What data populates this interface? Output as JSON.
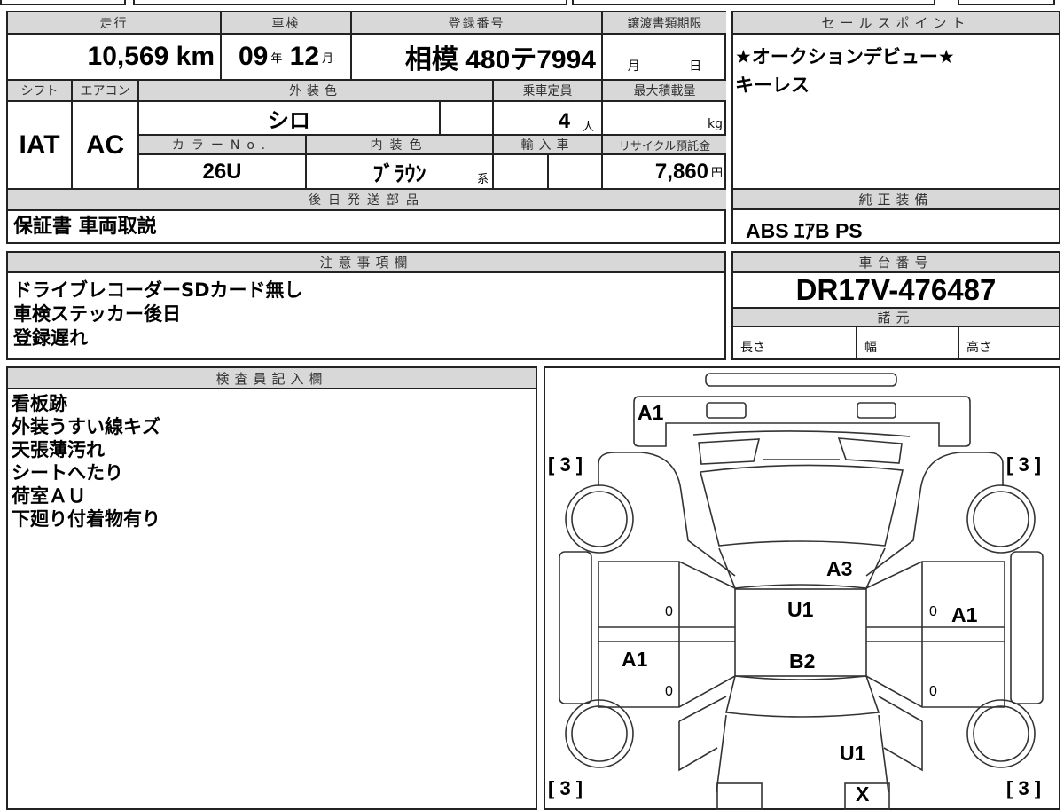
{
  "top_table": {
    "headers": {
      "mileage": "走行",
      "inspection": "車検",
      "registration": "登録番号",
      "transfer_deadline": "譲渡書類期限",
      "shift": "シフト",
      "aircon": "エアコン",
      "exterior_color": "外装色",
      "capacity": "乗車定員",
      "max_load": "最大積載量",
      "color_no": "カラーNo.",
      "interior_color": "内装色",
      "import": "輸入車",
      "recycle": "リサイクル預託金",
      "later_parts": "後日発送部品"
    },
    "mileage": "10,569",
    "mileage_unit": "km",
    "inspection_year": "09",
    "year_unit": "年",
    "inspection_month": "12",
    "month_unit": "月",
    "registration": "相模 480テ7994",
    "transfer_month_unit": "月",
    "transfer_day_unit": "日",
    "shift": "IAT",
    "aircon": "AC",
    "exterior_color": "シロ",
    "capacity": "4",
    "capacity_unit": "人",
    "max_load_unit": "kg",
    "color_no": "26U",
    "interior_color": "ﾌﾞﾗｳﾝ",
    "interior_suffix": "系",
    "recycle": "7,860",
    "recycle_unit": "円",
    "later_parts": "保証書 車両取説"
  },
  "sale_points": {
    "header": "セールスポイント",
    "lines": [
      "★オークションデビュー★",
      "キーレス"
    ]
  },
  "equipment": {
    "header": "純正装備",
    "value": "ABS ｴｱB PS"
  },
  "notes": {
    "header": "注意事項欄",
    "lines": [
      "ドライブレコーダーSDカード無し",
      "車検ステッカー後日",
      "登録遅れ"
    ]
  },
  "chassis": {
    "header": "車台番号",
    "value": "DR17V-476487",
    "specs_header": "諸元",
    "length": "長さ",
    "width": "幅",
    "height": "高さ"
  },
  "inspector": {
    "header": "検査員記入欄",
    "lines": [
      "看板跡",
      "外装うすい線キズ",
      "天張薄汚れ",
      "シートへたり",
      "荷室ＡＵ",
      "下廻り付着物有り"
    ]
  },
  "diagram": {
    "marks": {
      "front_bumper": "A1",
      "windshield_lower": "A3",
      "roof_front": "U1",
      "roof_rear": "B2",
      "right_door": "A1",
      "left_door": "A1",
      "rear": "U1",
      "rear_center": "X"
    },
    "tires": {
      "front_left": "[ 3 ]",
      "front_right": "[ 3 ]",
      "rear_left": "[ 3 ]",
      "rear_right": "[ 3 ]"
    },
    "zero": "0"
  }
}
